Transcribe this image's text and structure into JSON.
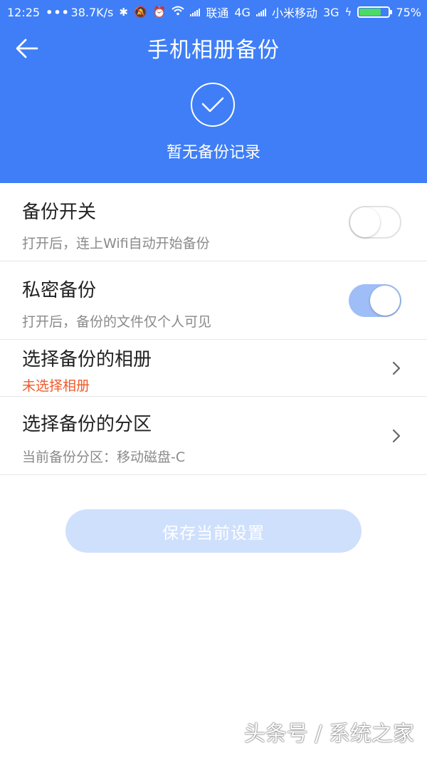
{
  "status_bar": {
    "time": "12:25",
    "dots": "•••",
    "speed": "38.7K/s",
    "carrier1": "联通",
    "net1": "4G",
    "carrier2": "小米移动",
    "net2": "3G",
    "battery": "75%",
    "battery_level": 0.75,
    "battery_color": "#4cd964"
  },
  "header": {
    "title": "手机相册备份",
    "status_text": "暂无备份记录",
    "accent_color": "#3f7ef6",
    "back_icon": "arrow-left-icon",
    "status_icon": "checkmark-circle-icon"
  },
  "settings": {
    "backup_switch": {
      "label": "备份开关",
      "description": "打开后，连上Wifi自动开始备份",
      "enabled": false
    },
    "private_backup": {
      "label": "私密备份",
      "description": "打开后，备份的文件仅个人可见",
      "enabled": true
    },
    "select_album": {
      "label": "选择备份的相册",
      "value": "未选择相册",
      "value_color": "#f05a2a"
    },
    "select_partition": {
      "label": "选择备份的分区",
      "value": "当前备份分区：移动磁盘-C"
    }
  },
  "save_button": {
    "label": "保存当前设置",
    "disabled": true
  },
  "watermark": "头条号 / 系统之家"
}
